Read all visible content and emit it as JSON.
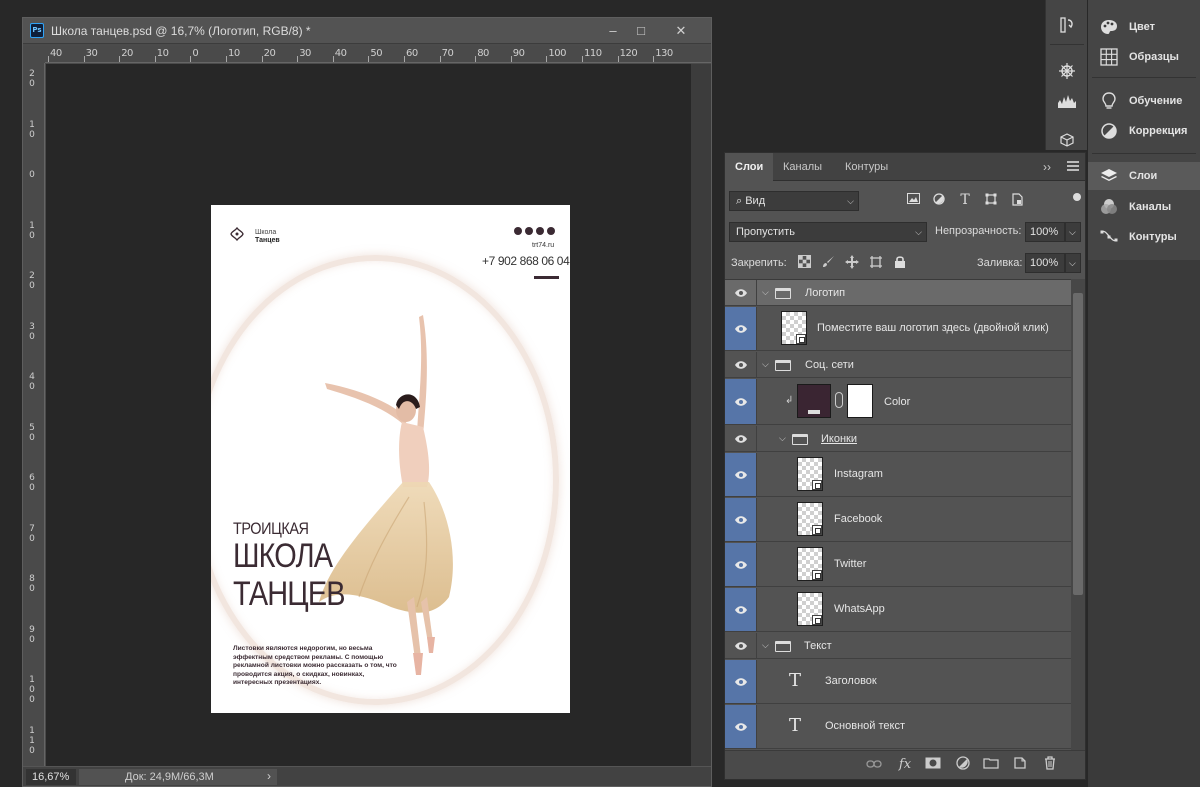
{
  "document": {
    "title": "Школа танцев.psd @ 16,7% (Логотип, RGB/8) *",
    "app_icon": "Ps",
    "window_buttons": [
      "–",
      "□",
      "✕"
    ],
    "ruler_h": [
      "40",
      "30",
      "20",
      "10",
      "0",
      "10",
      "20",
      "30",
      "40",
      "50",
      "60",
      "70",
      "80",
      "90",
      "100",
      "110",
      "120",
      "130"
    ],
    "ruler_v": [
      "20",
      "10",
      "0",
      "10",
      "20",
      "30",
      "40",
      "50",
      "60",
      "70",
      "80",
      "90",
      "100",
      "110"
    ],
    "zoom": "16,67%",
    "doc_size": "Док: 24,9M/66,3M",
    "status_arrow": "›"
  },
  "flyer": {
    "logo_line1": "Школа",
    "logo_line2": "Танцев",
    "site": "trt74.ru",
    "phone": "+7 902 868 06 04",
    "headline1": "ТРОИЦКАЯ",
    "headline2": "ШКОЛА",
    "headline3": "ТАНЦЕВ",
    "body": "Листовки являются недорогим, но весьма эффектным средством рекламы. С помощью рекламной листовки можно рассказать о том, что проводится акция, о скидках, новинках, интересных презентациях.",
    "social_icons": [
      "instagram-icon",
      "facebook-icon",
      "twitter-icon",
      "whatsapp-icon"
    ]
  },
  "dock_icons": [
    "history-icon",
    "navigator-icon",
    "histogram-icon",
    "3d-icon"
  ],
  "side_panels": [
    {
      "label": "Цвет",
      "icon": "palette-icon",
      "active": false
    },
    {
      "label": "Образцы",
      "icon": "swatches-icon",
      "active": false
    },
    {
      "label": "Обучение",
      "icon": "bulb-icon",
      "active": false
    },
    {
      "label": "Коррекция",
      "icon": "adjustment-icon",
      "active": false
    },
    {
      "label": "Слои",
      "icon": "layers-icon",
      "active": true
    },
    {
      "label": "Каналы",
      "icon": "channels-icon",
      "active": false
    },
    {
      "label": "Контуры",
      "icon": "paths-icon",
      "active": false
    }
  ],
  "layers_panel": {
    "tabs": [
      "Слои",
      "Каналы",
      "Контуры"
    ],
    "active_tab": "Слои",
    "collapse": "››",
    "filter_kind": "Вид",
    "blend_mode": "Пропустить",
    "opacity_label": "Непрозрачность:",
    "opacity": "100%",
    "lock_label": "Закрепить:",
    "fill_label": "Заливка:",
    "fill": "100%",
    "layers": [
      {
        "name": "Логотип",
        "type": "group",
        "indent": 0,
        "selected": true,
        "eye_blue": false
      },
      {
        "name": "Поместите ваш логотип здесь (двойной клик)",
        "type": "smart",
        "indent": 1,
        "selected": false,
        "eye_blue": true
      },
      {
        "name": "Соц. сети",
        "type": "group",
        "indent": 0,
        "selected": false,
        "eye_blue": false
      },
      {
        "name": "Color",
        "type": "fill",
        "indent": 1,
        "selected": false,
        "eye_blue": true
      },
      {
        "name": "Иконки",
        "type": "group",
        "indent": 1,
        "selected": false,
        "eye_blue": false
      },
      {
        "name": "Instagram",
        "type": "smart",
        "indent": 2,
        "selected": false,
        "eye_blue": true
      },
      {
        "name": "Facebook",
        "type": "smart",
        "indent": 2,
        "selected": false,
        "eye_blue": true
      },
      {
        "name": "Twitter",
        "type": "smart",
        "indent": 2,
        "selected": false,
        "eye_blue": true
      },
      {
        "name": "WhatsApp",
        "type": "smart",
        "indent": 2,
        "selected": false,
        "eye_blue": true
      },
      {
        "name": "Текст",
        "type": "group",
        "indent": 0,
        "selected": false,
        "eye_blue": false
      },
      {
        "name": "Заголовок",
        "type": "text",
        "indent": 1,
        "selected": false,
        "eye_blue": true
      },
      {
        "name": "Основной текст",
        "type": "text",
        "indent": 1,
        "selected": false,
        "eye_blue": true
      }
    ],
    "bottom_icons": [
      "link-icon",
      "fx-icon",
      "mask-icon",
      "adjustment-layer-icon",
      "folder-icon",
      "new-layer-icon",
      "trash-icon"
    ]
  },
  "colors": {
    "selection_blue": "#5675a8",
    "flyer_text": "#3b2b33",
    "panel_bg": "#535353"
  }
}
